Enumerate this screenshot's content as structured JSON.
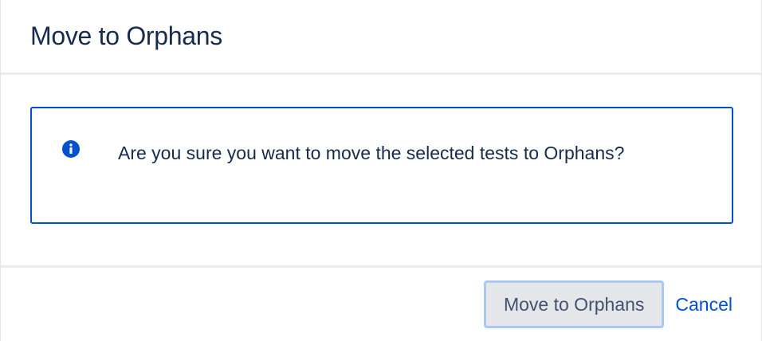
{
  "dialog": {
    "title": "Move to Orphans"
  },
  "message": {
    "icon": "info-icon",
    "text": "Are you sure you want to move the selected tests to Orphans?"
  },
  "footer": {
    "confirm_label": "Move to Orphans",
    "cancel_label": "Cancel"
  },
  "colors": {
    "accent": "#0052cc",
    "title_text": "#172b4d",
    "button_bg": "#e4e6ea",
    "button_focus_ring": "#a9c8f2"
  }
}
